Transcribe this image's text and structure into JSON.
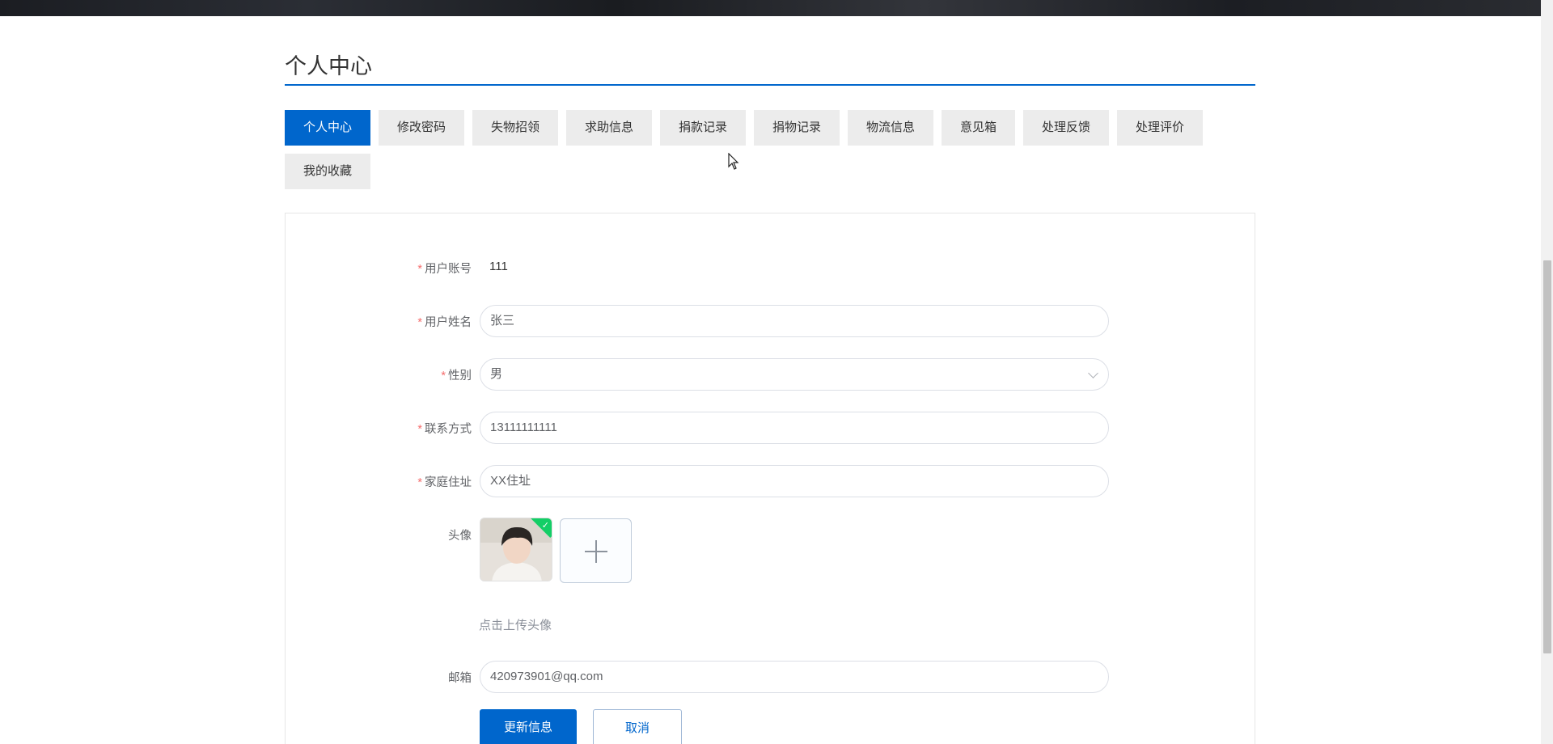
{
  "page": {
    "title": "个人中心"
  },
  "tabs": [
    {
      "label": "个人中心",
      "active": true
    },
    {
      "label": "修改密码",
      "active": false
    },
    {
      "label": "失物招领",
      "active": false
    },
    {
      "label": "求助信息",
      "active": false
    },
    {
      "label": "捐款记录",
      "active": false
    },
    {
      "label": "捐物记录",
      "active": false
    },
    {
      "label": "物流信息",
      "active": false
    },
    {
      "label": "意见箱",
      "active": false
    },
    {
      "label": "处理反馈",
      "active": false
    },
    {
      "label": "处理评价",
      "active": false
    },
    {
      "label": "我的收藏",
      "active": false
    }
  ],
  "form": {
    "account": {
      "label": "用户账号",
      "required_mark": "*",
      "value": "111"
    },
    "name": {
      "label": "用户姓名",
      "required_mark": "*",
      "value": "张三"
    },
    "gender": {
      "label": "性别",
      "required_mark": "*",
      "value": "男",
      "icon": "chevron-down-icon"
    },
    "phone": {
      "label": "联系方式",
      "required_mark": "*",
      "value": "13111111111"
    },
    "address": {
      "label": "家庭住址",
      "required_mark": "*",
      "value": "XX住址"
    },
    "avatar": {
      "label": "头像",
      "hint": "点击上传头像",
      "add_icon": "plus-icon",
      "status_icon": "check-icon"
    },
    "email": {
      "label": "邮箱",
      "value": "420973901@qq.com"
    }
  },
  "buttons": {
    "update": "更新信息",
    "cancel": "取消"
  },
  "colors": {
    "accent": "#0066cc",
    "required": "#f56c6c",
    "success": "#13ce66"
  }
}
